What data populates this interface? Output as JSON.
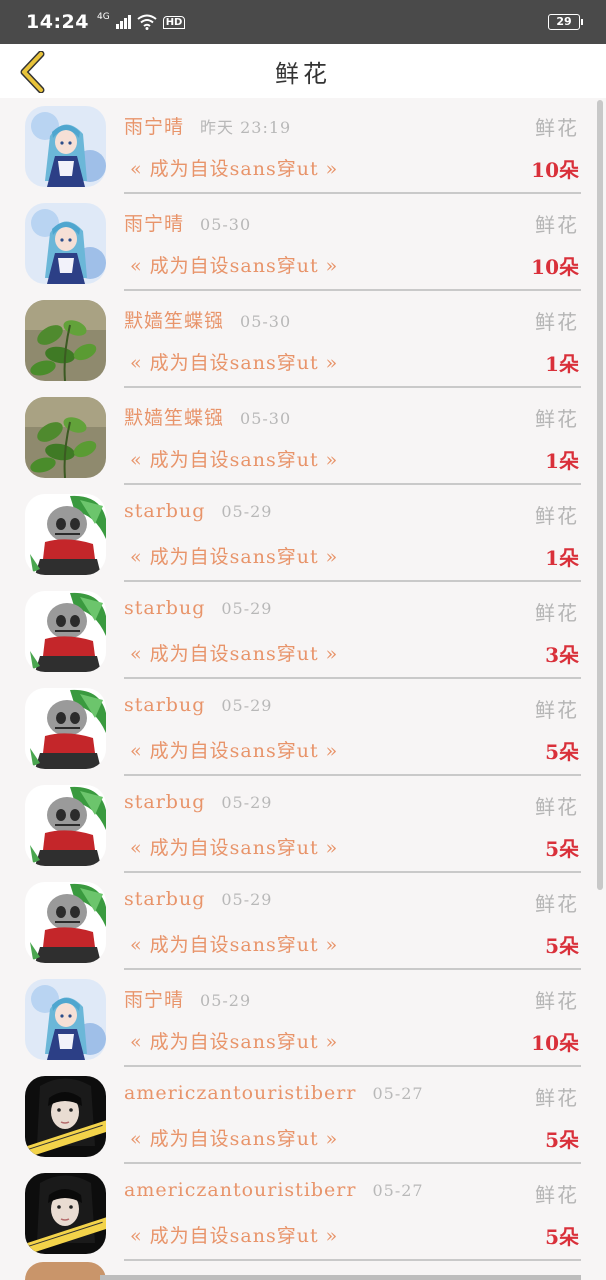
{
  "status": {
    "time": "14:24",
    "network": "4G",
    "hd": "HD",
    "battery": "29"
  },
  "header": {
    "title": "鲜花"
  },
  "items": [
    {
      "name": "雨宁晴",
      "time": "昨天 23:19",
      "type": "鲜花",
      "book": "« 成为自设sans穿ut »",
      "count": "10朵",
      "avatar": "anime-girl"
    },
    {
      "name": "雨宁晴",
      "time": "05-30",
      "type": "鲜花",
      "book": "« 成为自设sans穿ut »",
      "count": "10朵",
      "avatar": "anime-girl"
    },
    {
      "name": "默嫱笙蝶镪",
      "time": "05-30",
      "type": "鲜花",
      "book": "« 成为自设sans穿ut »",
      "count": "1朵",
      "avatar": "plant"
    },
    {
      "name": "默嫱笙蝶镪",
      "time": "05-30",
      "type": "鲜花",
      "book": "« 成为自设sans穿ut »",
      "count": "1朵",
      "avatar": "plant"
    },
    {
      "name": "starbug",
      "time": "05-29",
      "type": "鲜花",
      "book": "« 成为自设sans穿ut »",
      "count": "1朵",
      "avatar": "skeleton"
    },
    {
      "name": "starbug",
      "time": "05-29",
      "type": "鲜花",
      "book": "« 成为自设sans穿ut »",
      "count": "3朵",
      "avatar": "skeleton"
    },
    {
      "name": "starbug",
      "time": "05-29",
      "type": "鲜花",
      "book": "« 成为自设sans穿ut »",
      "count": "5朵",
      "avatar": "skeleton"
    },
    {
      "name": "starbug",
      "time": "05-29",
      "type": "鲜花",
      "book": "« 成为自设sans穿ut »",
      "count": "5朵",
      "avatar": "skeleton"
    },
    {
      "name": "starbug",
      "time": "05-29",
      "type": "鲜花",
      "book": "« 成为自设sans穿ut »",
      "count": "5朵",
      "avatar": "skeleton"
    },
    {
      "name": "雨宁晴",
      "time": "05-29",
      "type": "鲜花",
      "book": "« 成为自设sans穿ut »",
      "count": "10朵",
      "avatar": "anime-girl"
    },
    {
      "name": "americzantouristiberr",
      "time": "05-27",
      "type": "鲜花",
      "book": "« 成为自设sans穿ut »",
      "count": "5朵",
      "avatar": "dark-hair-girl"
    },
    {
      "name": "americzantouristiberr",
      "time": "05-27",
      "type": "鲜花",
      "book": "« 成为自设sans穿ut »",
      "count": "5朵",
      "avatar": "dark-hair-girl"
    }
  ],
  "colors": {
    "accent": "#e8946a",
    "count": "#d9303a",
    "muted": "#b5b5b5",
    "back": "#e8c33a"
  }
}
